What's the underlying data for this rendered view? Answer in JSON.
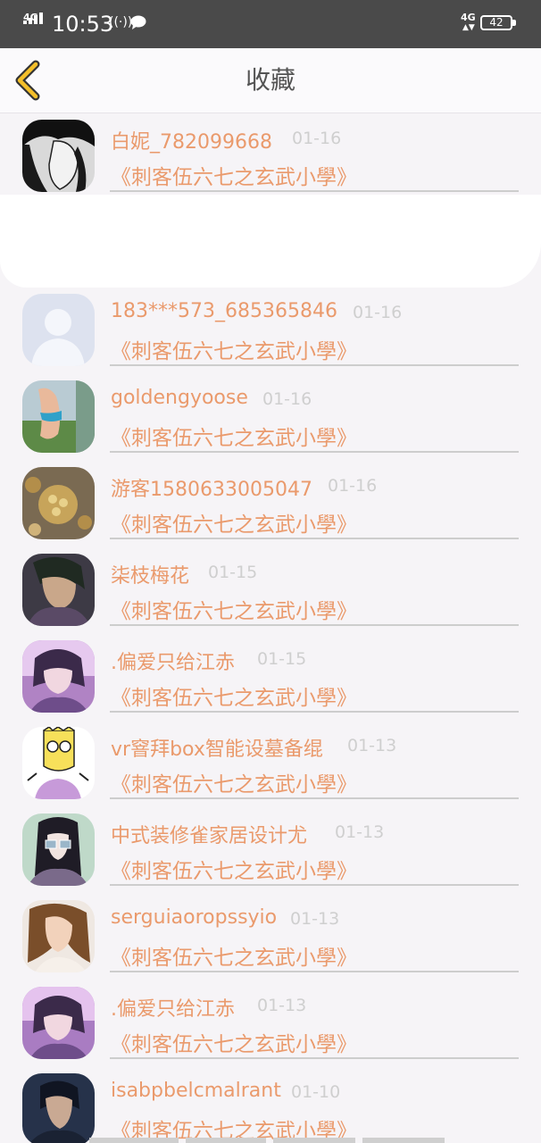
{
  "status_bar": {
    "network_left": "4G",
    "time": "10:53",
    "network_right": "4G",
    "battery": "42"
  },
  "nav": {
    "title": "收藏"
  },
  "items": [
    {
      "name": "白妮_782099668",
      "date": "01-16",
      "title": "《刺客伍六七之玄武小學》"
    },
    {
      "name": "183***573_685365846",
      "date": "01-16",
      "title": "《刺客伍六七之玄武小學》"
    },
    {
      "name": "goldengyoose",
      "date": "01-16",
      "title": "《刺客伍六七之玄武小學》"
    },
    {
      "name": "游客1580633005047",
      "date": "01-16",
      "title": "《刺客伍六七之玄武小學》"
    },
    {
      "name": "柒枝梅花",
      "date": "01-15",
      "title": "《刺客伍六七之玄武小學》"
    },
    {
      "name": ".偏爱只给江赤",
      "date": "01-15",
      "title": "《刺客伍六七之玄武小學》"
    },
    {
      "name": "vr窨拜box智能设墓备绲",
      "date": "01-13",
      "title": "《刺客伍六七之玄武小學》"
    },
    {
      "name": "中式装修雀家居设计尤",
      "date": "01-13",
      "title": "《刺客伍六七之玄武小學》"
    },
    {
      "name": "serguiaoropssyio",
      "date": "01-13",
      "title": "《刺客伍六七之玄武小學》"
    },
    {
      "name": ".偏爱只给江赤",
      "date": "01-13",
      "title": "《刺客伍六七之玄武小學》"
    },
    {
      "name": "isabpbelcmalrant",
      "date": "01-10",
      "title": "《刺客伍六七之玄武小學》"
    }
  ]
}
